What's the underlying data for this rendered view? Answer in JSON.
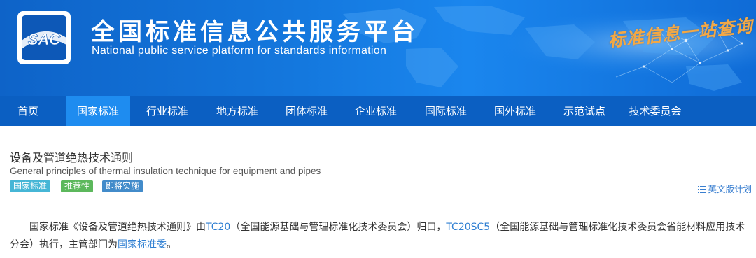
{
  "header": {
    "title_cn": "全国标准信息公共服务平台",
    "title_en": "National public service platform  for standards information",
    "slogan": "标准信息一站查询",
    "logo_text": "SAC"
  },
  "nav": {
    "items": [
      {
        "label": "首页"
      },
      {
        "label": "国家标准"
      },
      {
        "label": "行业标准"
      },
      {
        "label": "地方标准"
      },
      {
        "label": "团体标准"
      },
      {
        "label": "企业标准"
      },
      {
        "label": "国际标准"
      },
      {
        "label": "国外标准"
      },
      {
        "label": "示范试点"
      },
      {
        "label": "技术委员会"
      }
    ],
    "active_index": 1
  },
  "standard": {
    "title_cn": "设备及管道绝热技术通则",
    "title_en": "General principles of thermal insulation technique for equipment and pipes",
    "badges": [
      "国家标准",
      "推荐性",
      "即将实施"
    ],
    "english_plan_link": "英文版计划"
  },
  "description": {
    "p1": "国家标准《设备及管道绝热技术通则》由",
    "tc_code": "TC20",
    "p2": "（全国能源基础与管理标准化技术委员会）归口，",
    "sc_code": "TC20SC5",
    "p3": "（全国能源基础与管理标准化技术委员会省能材料应用技术分会）执行，主管部门为",
    "authority": "国家标准委",
    "p4": "。"
  },
  "colors": {
    "nav_bg": "#0b5fc2",
    "nav_active": "#1e8cf0",
    "link": "#2f7fd2",
    "badge_national": "#46b6d6",
    "badge_recommended": "#5cb85c",
    "badge_upcoming": "#428bca"
  }
}
